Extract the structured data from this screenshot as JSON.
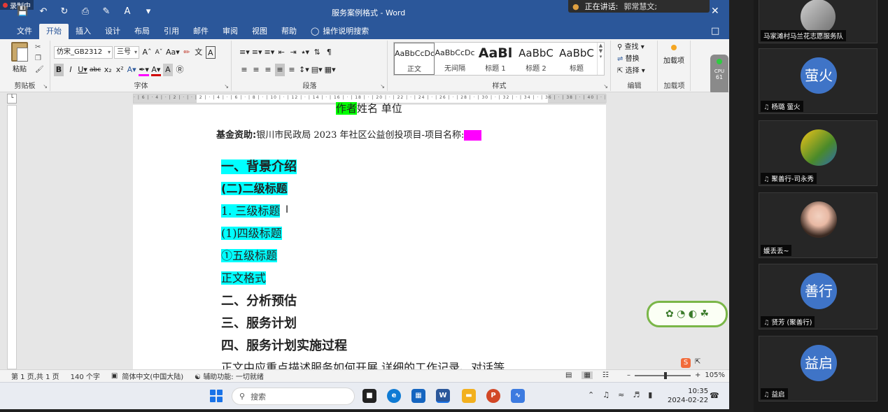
{
  "recording": {
    "label": "录制中"
  },
  "title_bar": {
    "doc_title": "服务案例格式 - Word",
    "speaking_label": "正在讲话:",
    "speaker": "郭常慧文;"
  },
  "tabs": [
    "文件",
    "开始",
    "插入",
    "设计",
    "布局",
    "引用",
    "邮件",
    "审阅",
    "视图",
    "帮助"
  ],
  "tell_me": "操作说明搜索",
  "ribbon": {
    "clipboard": {
      "paste": "粘贴",
      "label": "剪贴板"
    },
    "font": {
      "name": "仿宋_GB2312",
      "size": "三号",
      "label": "字体"
    },
    "paragraph": {
      "label": "段落"
    },
    "styles": {
      "label": "样式",
      "items": [
        {
          "sample": "AaBbCcDc",
          "name": "正文"
        },
        {
          "sample": "AaBbCcDc",
          "name": "无间隔"
        },
        {
          "sample": "AaBl",
          "name": "标题 1"
        },
        {
          "sample": "AaBbC",
          "name": "标题 2"
        },
        {
          "sample": "AaBbC",
          "name": "标题"
        }
      ]
    },
    "editing": {
      "find": "查找",
      "replace": "替换",
      "select": "选择",
      "label": "编辑"
    },
    "addins": {
      "button": "加载项",
      "label": "加载项"
    }
  },
  "widget": {
    "label": "CPU",
    "value": "61"
  },
  "document": {
    "author_hl": "作者",
    "author_rest": "姓名 单位",
    "fund_label": "基金资助:",
    "fund_text": "银川市民政局 2023 年社区公益创投项目-项目名称:",
    "fund_blank": "······",
    "h1": "一、背景介绍",
    "h2": "(二)二级标题",
    "h3": "1. 三级标题",
    "h4": "(1)四级标题",
    "h5": "①五级标题",
    "body_fmt": "正文格式",
    "s2": "二、分析预估",
    "s3": "三、服务计划",
    "s4": "四、服务计划实施过程",
    "body": "正文中应重点描述服务如何开展,详细的工作记录、对话等"
  },
  "status": {
    "page": "第 1 页,共 1 页",
    "words": "140 个字",
    "lang": "简体中文(中国大陆)",
    "accessibility": "辅助功能: 一切就绪",
    "zoom": "105%"
  },
  "taskbar": {
    "search": "搜索",
    "time": "10:35",
    "date": "2024-02-22"
  },
  "participants": [
    {
      "name": "马家滩村马兰花志愿服务队",
      "avatar": ""
    },
    {
      "name": "杨璐 萤火",
      "avatar": "萤火"
    },
    {
      "name": "聚善行-司永秀",
      "avatar": ""
    },
    {
      "name": "媛丢丢~",
      "avatar": ""
    },
    {
      "name": "贤芳 (聚善行)",
      "avatar": "善行"
    },
    {
      "name": "益启",
      "avatar": "益启"
    }
  ]
}
